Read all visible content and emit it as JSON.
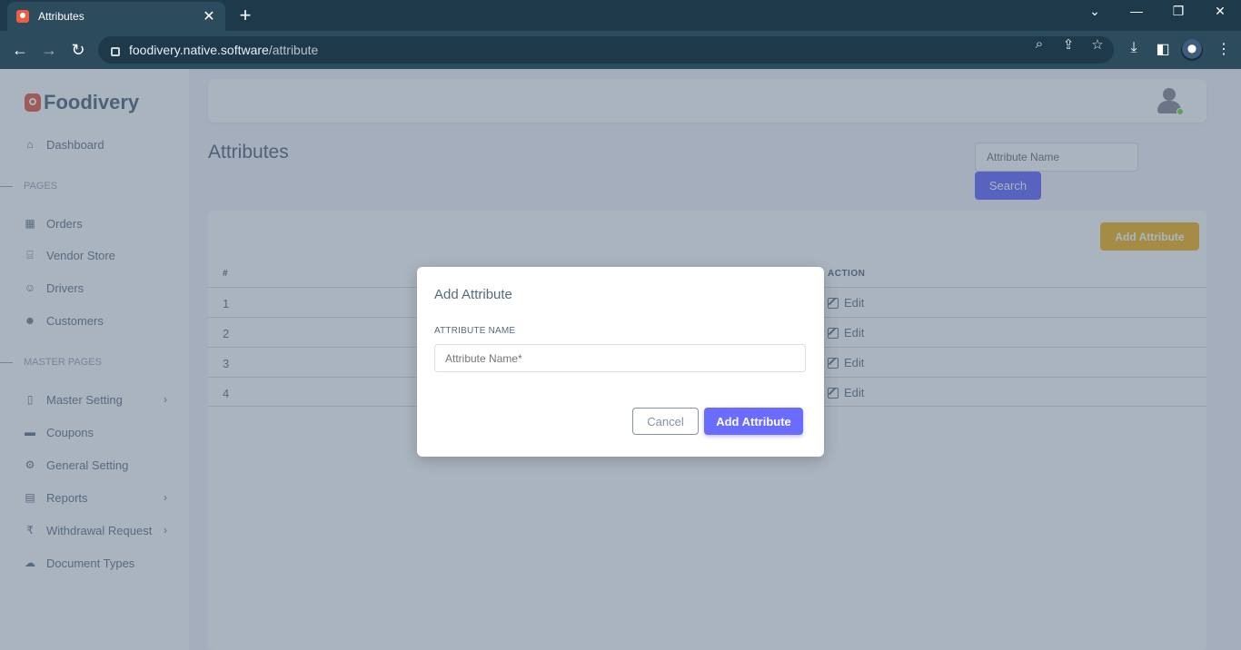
{
  "browser": {
    "tab_title": "Attributes",
    "url_domain": "foodivery.native.software",
    "url_path": "/attribute"
  },
  "sidebar": {
    "brand": "Foodivery",
    "dashboard": "Dashboard",
    "section_pages": "PAGES",
    "pages": [
      "Orders",
      "Vendor Store",
      "Drivers",
      "Customers"
    ],
    "section_master": "MASTER PAGES",
    "master": [
      "Master Setting",
      "Coupons",
      "General Setting",
      "Reports",
      "Withdrawal Request",
      "Document Types"
    ]
  },
  "main": {
    "title": "Attributes",
    "search_placeholder": "Attribute Name",
    "search_button": "Search",
    "add_button": "Add Attribute",
    "table": {
      "col_num": "#",
      "col_action": "ACTION",
      "rows": [
        {
          "num": "1",
          "action": "Edit"
        },
        {
          "num": "2",
          "action": "Edit"
        },
        {
          "num": "3",
          "action": "Edit"
        },
        {
          "num": "4",
          "action": "Edit"
        }
      ]
    }
  },
  "modal": {
    "title": "Add Attribute",
    "field_label": "ATTRIBUTE NAME",
    "field_placeholder": "Attribute Name*",
    "field_value": "",
    "cancel_label": "Cancel",
    "confirm_label": "Add Attribute"
  },
  "colors": {
    "primary": "#696cff",
    "warning": "#f5b623",
    "brand": "#ea5f44"
  }
}
